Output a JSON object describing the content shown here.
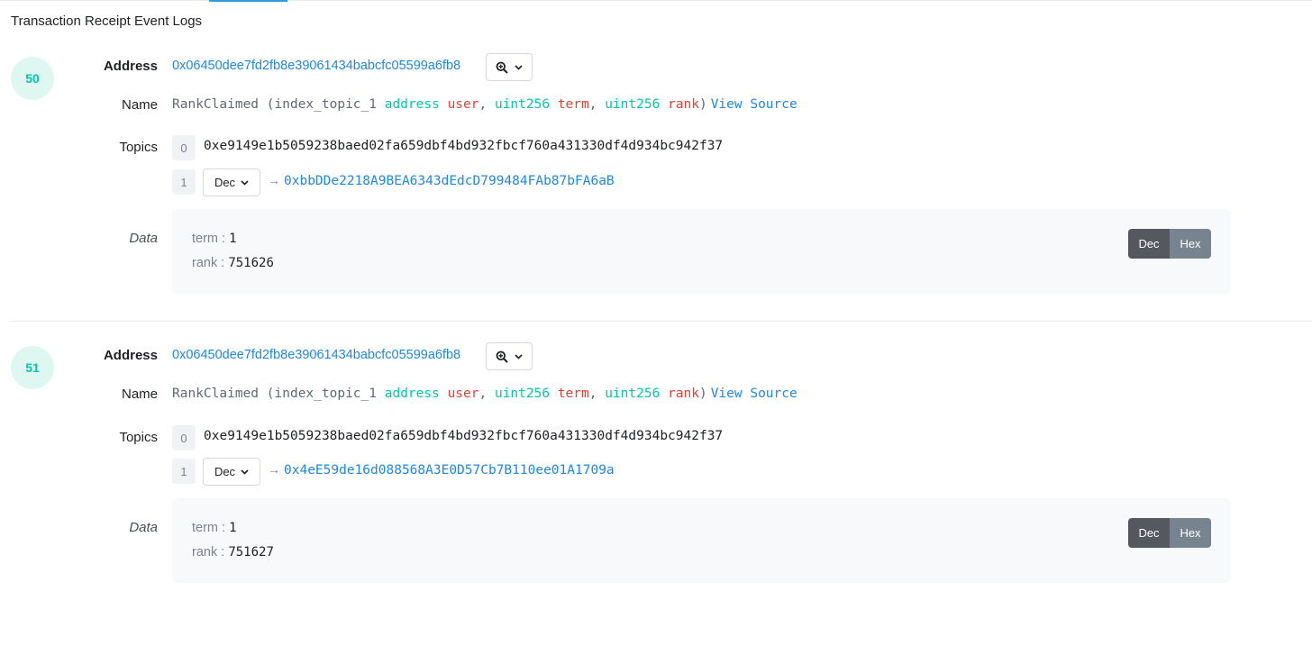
{
  "section_title": "Transaction Receipt Event Logs",
  "labels": {
    "address": "Address",
    "name": "Name",
    "topics": "Topics",
    "data": "Data",
    "view_source": "View Source",
    "dec": "Dec",
    "hex": "Hex"
  },
  "event_signature": {
    "event_name": "RankClaimed",
    "open": "(",
    "close": ")",
    "sep": ",",
    "params": [
      {
        "prefix": "index_topic_1",
        "type": "address",
        "name": "user"
      },
      {
        "prefix": "",
        "type": "uint256",
        "name": "term"
      },
      {
        "prefix": "",
        "type": "uint256",
        "name": "rank"
      }
    ]
  },
  "logs": [
    {
      "index": "50",
      "address": "0x06450dee7fd2fb8e39061434babcfc05599a6fb8",
      "topics": [
        {
          "idx": "0",
          "value": "0xe9149e1b5059238baed02fa659dbf4bd932fbcf760a431330df4d934bc942f37"
        },
        {
          "idx": "1",
          "format": "Dec",
          "arrow": "→",
          "value": "0xbbDDe2218A9BEA6343dEdcD799484FAb87bFA6aB"
        }
      ],
      "data": [
        {
          "key": "term",
          "sep": " : ",
          "value": "1"
        },
        {
          "key": "rank",
          "sep": " : ",
          "value": "751626"
        }
      ]
    },
    {
      "index": "51",
      "address": "0x06450dee7fd2fb8e39061434babcfc05599a6fb8",
      "topics": [
        {
          "idx": "0",
          "value": "0xe9149e1b5059238baed02fa659dbf4bd932fbcf760a431330df4d934bc942f37"
        },
        {
          "idx": "1",
          "format": "Dec",
          "arrow": "→",
          "value": "0x4eE59de16d088568A3E0D57Cb7B110ee01A1709a"
        }
      ],
      "data": [
        {
          "key": "term",
          "sep": " : ",
          "value": "1"
        },
        {
          "key": "rank",
          "sep": " : ",
          "value": "751627"
        }
      ]
    }
  ],
  "icons": {
    "zoom": "search-plus-icon",
    "chevron": "chevron-down-icon",
    "arrow": "arrow-right-icon"
  }
}
